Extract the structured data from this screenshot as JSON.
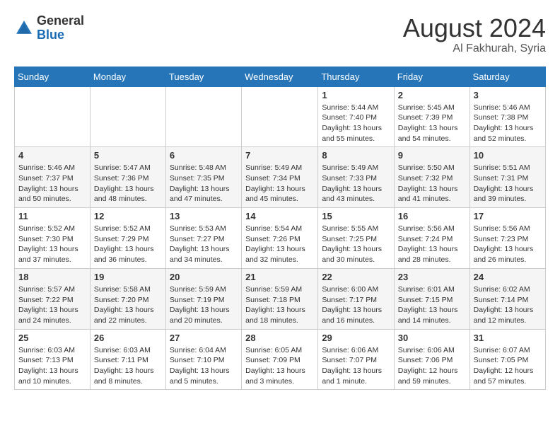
{
  "logo": {
    "general": "General",
    "blue": "Blue"
  },
  "title": {
    "month": "August 2024",
    "location": "Al Fakhurah, Syria"
  },
  "weekdays": [
    "Sunday",
    "Monday",
    "Tuesday",
    "Wednesday",
    "Thursday",
    "Friday",
    "Saturday"
  ],
  "weeks": [
    [
      {
        "day": "",
        "info": ""
      },
      {
        "day": "",
        "info": ""
      },
      {
        "day": "",
        "info": ""
      },
      {
        "day": "",
        "info": ""
      },
      {
        "day": "1",
        "info": "Sunrise: 5:44 AM\nSunset: 7:40 PM\nDaylight: 13 hours\nand 55 minutes."
      },
      {
        "day": "2",
        "info": "Sunrise: 5:45 AM\nSunset: 7:39 PM\nDaylight: 13 hours\nand 54 minutes."
      },
      {
        "day": "3",
        "info": "Sunrise: 5:46 AM\nSunset: 7:38 PM\nDaylight: 13 hours\nand 52 minutes."
      }
    ],
    [
      {
        "day": "4",
        "info": "Sunrise: 5:46 AM\nSunset: 7:37 PM\nDaylight: 13 hours\nand 50 minutes."
      },
      {
        "day": "5",
        "info": "Sunrise: 5:47 AM\nSunset: 7:36 PM\nDaylight: 13 hours\nand 48 minutes."
      },
      {
        "day": "6",
        "info": "Sunrise: 5:48 AM\nSunset: 7:35 PM\nDaylight: 13 hours\nand 47 minutes."
      },
      {
        "day": "7",
        "info": "Sunrise: 5:49 AM\nSunset: 7:34 PM\nDaylight: 13 hours\nand 45 minutes."
      },
      {
        "day": "8",
        "info": "Sunrise: 5:49 AM\nSunset: 7:33 PM\nDaylight: 13 hours\nand 43 minutes."
      },
      {
        "day": "9",
        "info": "Sunrise: 5:50 AM\nSunset: 7:32 PM\nDaylight: 13 hours\nand 41 minutes."
      },
      {
        "day": "10",
        "info": "Sunrise: 5:51 AM\nSunset: 7:31 PM\nDaylight: 13 hours\nand 39 minutes."
      }
    ],
    [
      {
        "day": "11",
        "info": "Sunrise: 5:52 AM\nSunset: 7:30 PM\nDaylight: 13 hours\nand 37 minutes."
      },
      {
        "day": "12",
        "info": "Sunrise: 5:52 AM\nSunset: 7:29 PM\nDaylight: 13 hours\nand 36 minutes."
      },
      {
        "day": "13",
        "info": "Sunrise: 5:53 AM\nSunset: 7:27 PM\nDaylight: 13 hours\nand 34 minutes."
      },
      {
        "day": "14",
        "info": "Sunrise: 5:54 AM\nSunset: 7:26 PM\nDaylight: 13 hours\nand 32 minutes."
      },
      {
        "day": "15",
        "info": "Sunrise: 5:55 AM\nSunset: 7:25 PM\nDaylight: 13 hours\nand 30 minutes."
      },
      {
        "day": "16",
        "info": "Sunrise: 5:56 AM\nSunset: 7:24 PM\nDaylight: 13 hours\nand 28 minutes."
      },
      {
        "day": "17",
        "info": "Sunrise: 5:56 AM\nSunset: 7:23 PM\nDaylight: 13 hours\nand 26 minutes."
      }
    ],
    [
      {
        "day": "18",
        "info": "Sunrise: 5:57 AM\nSunset: 7:22 PM\nDaylight: 13 hours\nand 24 minutes."
      },
      {
        "day": "19",
        "info": "Sunrise: 5:58 AM\nSunset: 7:20 PM\nDaylight: 13 hours\nand 22 minutes."
      },
      {
        "day": "20",
        "info": "Sunrise: 5:59 AM\nSunset: 7:19 PM\nDaylight: 13 hours\nand 20 minutes."
      },
      {
        "day": "21",
        "info": "Sunrise: 5:59 AM\nSunset: 7:18 PM\nDaylight: 13 hours\nand 18 minutes."
      },
      {
        "day": "22",
        "info": "Sunrise: 6:00 AM\nSunset: 7:17 PM\nDaylight: 13 hours\nand 16 minutes."
      },
      {
        "day": "23",
        "info": "Sunrise: 6:01 AM\nSunset: 7:15 PM\nDaylight: 13 hours\nand 14 minutes."
      },
      {
        "day": "24",
        "info": "Sunrise: 6:02 AM\nSunset: 7:14 PM\nDaylight: 13 hours\nand 12 minutes."
      }
    ],
    [
      {
        "day": "25",
        "info": "Sunrise: 6:03 AM\nSunset: 7:13 PM\nDaylight: 13 hours\nand 10 minutes."
      },
      {
        "day": "26",
        "info": "Sunrise: 6:03 AM\nSunset: 7:11 PM\nDaylight: 13 hours\nand 8 minutes."
      },
      {
        "day": "27",
        "info": "Sunrise: 6:04 AM\nSunset: 7:10 PM\nDaylight: 13 hours\nand 5 minutes."
      },
      {
        "day": "28",
        "info": "Sunrise: 6:05 AM\nSunset: 7:09 PM\nDaylight: 13 hours\nand 3 minutes."
      },
      {
        "day": "29",
        "info": "Sunrise: 6:06 AM\nSunset: 7:07 PM\nDaylight: 13 hours\nand 1 minute."
      },
      {
        "day": "30",
        "info": "Sunrise: 6:06 AM\nSunset: 7:06 PM\nDaylight: 12 hours\nand 59 minutes."
      },
      {
        "day": "31",
        "info": "Sunrise: 6:07 AM\nSunset: 7:05 PM\nDaylight: 12 hours\nand 57 minutes."
      }
    ]
  ]
}
